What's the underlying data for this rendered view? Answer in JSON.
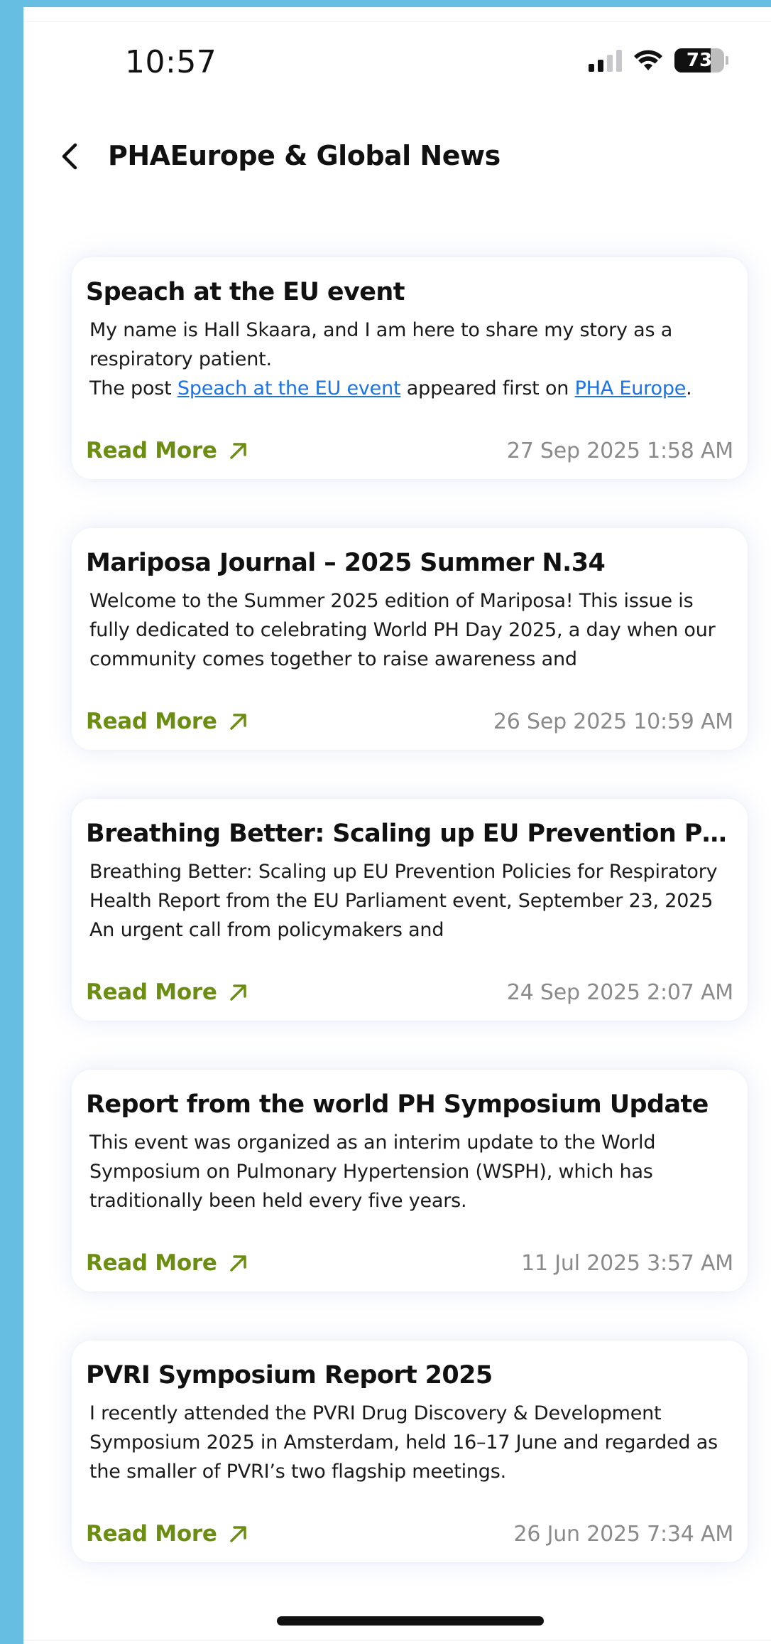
{
  "status_bar": {
    "time": "10:57",
    "battery": "73",
    "battery_level": 0.73
  },
  "header": {
    "title": "PHAEurope & Global News"
  },
  "articles": [
    {
      "title": "Speach at the EU event",
      "body_line1": "My name is Hall Skaara, and I am here to share my story as a respiratory patient.",
      "body_prefix": "The post ",
      "body_link1": "Speach at the EU event",
      "body_mid": " appeared first on ",
      "body_link2": "PHA Europe",
      "body_suffix": ".",
      "read_more": "Read More",
      "date": "27 Sep 2025 1:58 AM"
    },
    {
      "title": "Mariposa Journal – 2025 Summer N.34",
      "body": "Welcome to the Summer 2025 edition of Mariposa! This issue is fully dedicated to celebrating World PH Day 2025, a day when our community comes together to raise awareness and",
      "read_more": "Read More",
      "date": "26 Sep 2025 10:59 AM"
    },
    {
      "title": "Breathing Better: Scaling up EU Prevention Policies for Respiratory Health",
      "body": "Breathing Better: Scaling up EU Prevention Policies for Respiratory Health Report from the EU Parliament event, September 23, 2025 An urgent call from policymakers and",
      "read_more": "Read More",
      "date": "24 Sep 2025 2:07 AM"
    },
    {
      "title": "Report from the world PH Symposium Update",
      "body": "This event was organized as an interim update to the World Symposium on Pulmonary Hypertension (WSPH), which has traditionally been held every five years.",
      "read_more": "Read More",
      "date": "11 Jul 2025 3:57 AM"
    },
    {
      "title": "PVRI Symposium Report 2025",
      "body": "I recently attended the PVRI Drug Discovery & Development Symposium 2025 in Amsterdam, held 16–17 June and regarded as the smaller of PVRI’s two flagship meetings.",
      "read_more": "Read More",
      "date": "26 Jun 2025 7:34 AM"
    }
  ],
  "icons": {
    "back": "chevron-left-icon",
    "read_more": "arrow-up-right-icon",
    "signal": "cellular-signal-icon",
    "wifi": "wifi-icon",
    "battery": "battery-icon"
  },
  "colors": {
    "background": "#66bfe3",
    "accent": "#6b8e12",
    "link": "#1a73e8",
    "date": "#8a8a8a"
  }
}
